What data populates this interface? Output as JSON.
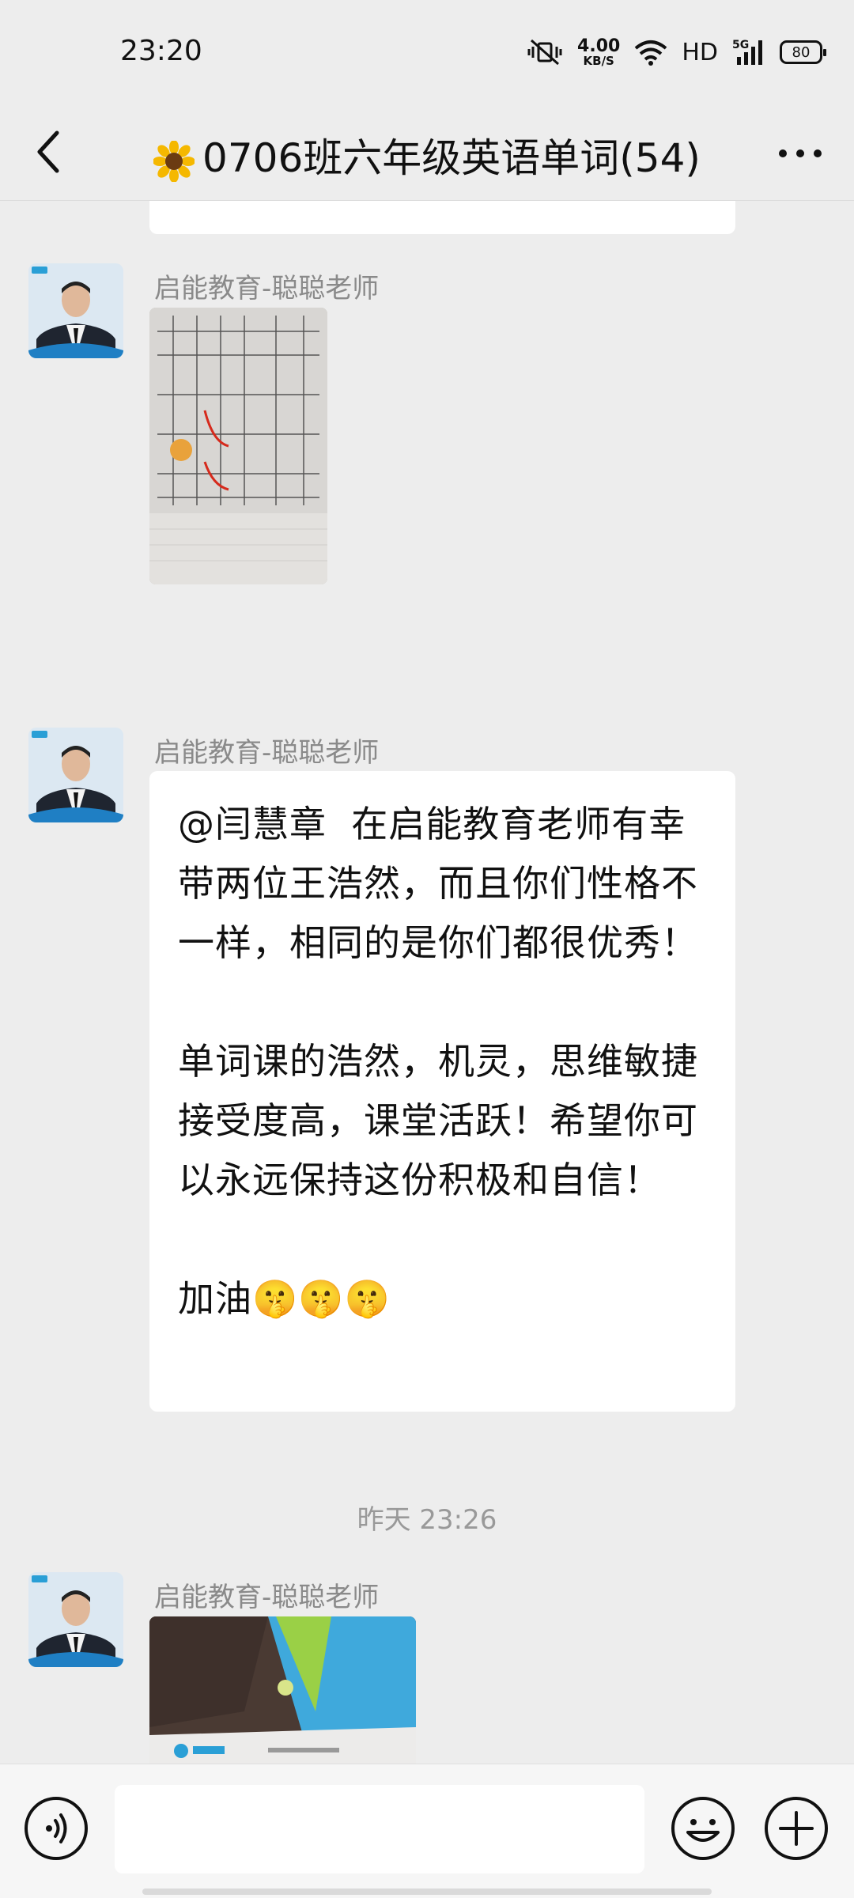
{
  "status": {
    "time": "23:20",
    "speed_value": "4.00",
    "speed_unit": "KB/S",
    "network": "HD",
    "cell": "5G",
    "battery": "80"
  },
  "header": {
    "title": "0706班六年级英语单词(54)"
  },
  "messages": [
    {
      "sender": "启能教育-聪聪老师",
      "type": "image"
    },
    {
      "sender": "启能教育-聪聪老师",
      "type": "text",
      "text": "@闫慧章  在启能教育老师有幸带两位王浩然，而且你们性格不一样，相同的是你们都很优秀！\n\n单词课的浩然，机灵，思维敏捷接受度高，课堂活跃！希望你可以永远保持这份积极和自信！\n\n加油🤫🤫🤫"
    }
  ],
  "timestamp": "昨天 23:26",
  "last_message": {
    "sender": "启能教育-聪聪老师",
    "type": "image"
  },
  "colors": {
    "background": "#ededed",
    "bubble": "#ffffff",
    "sender": "#8a8a8a"
  }
}
